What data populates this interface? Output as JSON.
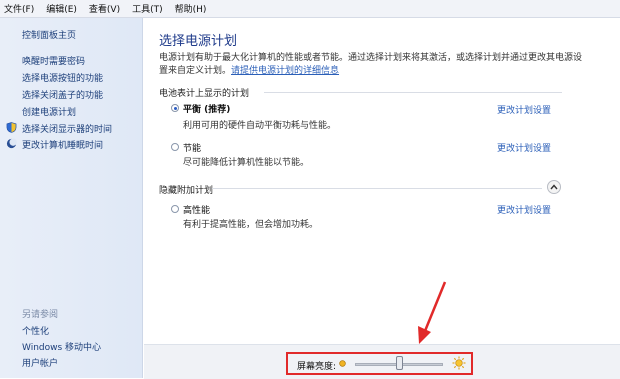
{
  "menubar": {
    "items": [
      "文件(F)",
      "编辑(E)",
      "查看(V)",
      "工具(T)",
      "帮助(H)"
    ]
  },
  "sidebar": {
    "home": "控制面板主页",
    "items": [
      {
        "label": "唤醒时需要密码"
      },
      {
        "label": "选择电源按钮的功能"
      },
      {
        "label": "选择关闭盖子的功能"
      },
      {
        "label": "创建电源计划"
      },
      {
        "label": "选择关闭显示器的时间",
        "icon": "shield-icon"
      },
      {
        "label": "更改计算机睡眠时间",
        "icon": "moon-icon"
      }
    ],
    "see_also_title": "另请参阅",
    "see_also": [
      "个性化",
      "Windows 移动中心",
      "用户帐户"
    ]
  },
  "main": {
    "title": "选择电源计划",
    "description": "电源计划有助于最大化计算机的性能或者节能。通过选择计划来将其激活，或选择计划并通过更改其电源设置来自定义计划。",
    "description_link": "请提供电源计划的详细信息",
    "battery_section_title": "电池表计上显示的计划",
    "hidden_section_title": "隐藏附加计划",
    "plans": [
      {
        "name": "平衡 (推荐)",
        "desc": "利用可用的硬件自动平衡功耗与性能。",
        "link": "更改计划设置",
        "selected": true
      },
      {
        "name": "节能",
        "desc": "尽可能降低计算机性能以节能。",
        "link": "更改计划设置",
        "selected": false
      }
    ],
    "hidden_plans": [
      {
        "name": "高性能",
        "desc": "有利于提高性能，但会增加功耗。",
        "link": "更改计划设置",
        "selected": false
      }
    ]
  },
  "brightness": {
    "label": "屏幕亮度:",
    "level_fraction": 0.5,
    "dim_icon": "sun-dim-icon",
    "bright_icon": "sun-bright-icon"
  },
  "colors": {
    "link": "#2b5fb8",
    "title": "#1e3a8a",
    "highlight": "#e12a2a"
  }
}
